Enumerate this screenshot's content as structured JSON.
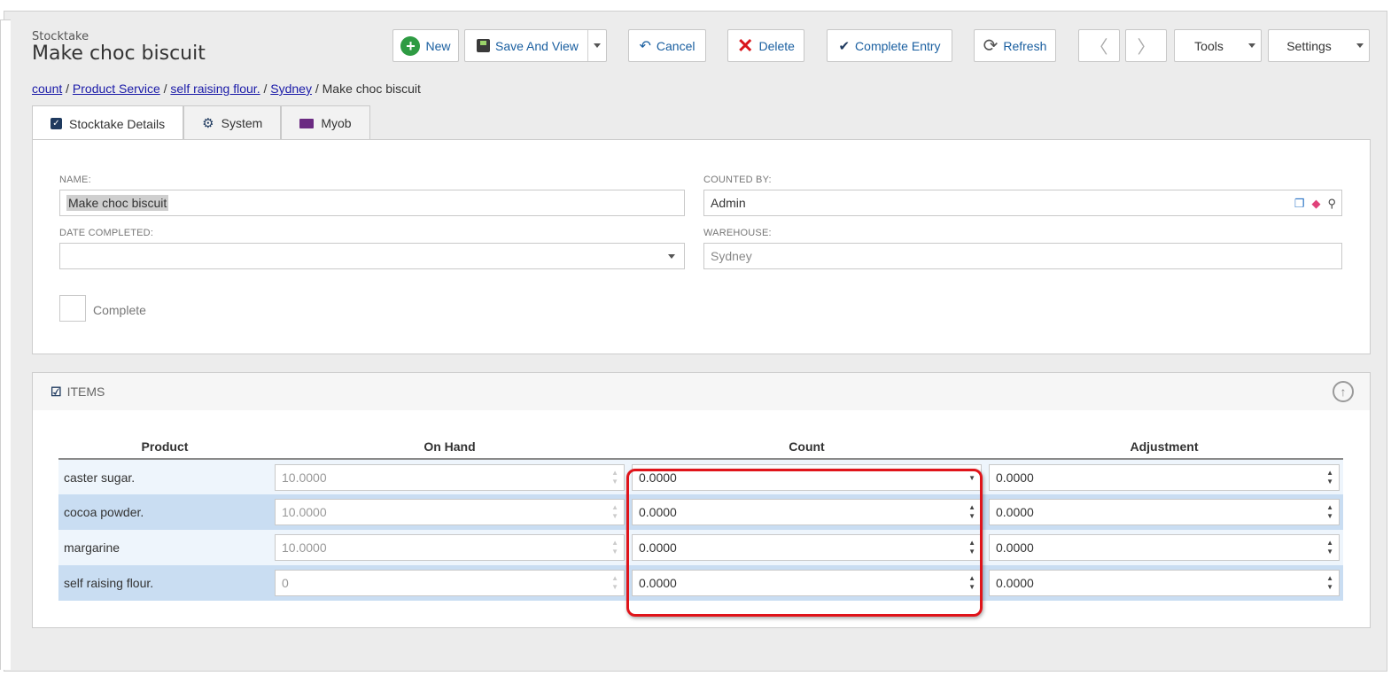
{
  "header": {
    "subtitle": "Stocktake",
    "title": "Make choc biscuit"
  },
  "toolbar": {
    "new_label": "New",
    "save_label": "Save And View",
    "cancel_label": "Cancel",
    "delete_label": "Delete",
    "complete_label": "Complete Entry",
    "refresh_label": "Refresh",
    "prev_label": "〈",
    "next_label": "〉",
    "tools_label": "Tools",
    "settings_label": "Settings"
  },
  "breadcrumb": {
    "items": [
      "count",
      "Product Service",
      "self raising flour.",
      "Sydney"
    ],
    "current": "Make choc biscuit",
    "sep": "/"
  },
  "tabs": [
    {
      "label": "Stocktake Details"
    },
    {
      "label": "System"
    },
    {
      "label": "Myob"
    }
  ],
  "form": {
    "name_label": "NAME:",
    "name_value": "Make choc biscuit",
    "counted_by_label": "COUNTED BY:",
    "counted_by_value": "Admin",
    "date_label": "DATE COMPLETED:",
    "date_value": "",
    "warehouse_label": "WAREHOUSE:",
    "warehouse_value": "Sydney",
    "complete_label": "Complete"
  },
  "items": {
    "title": "ITEMS",
    "columns": [
      "Product",
      "On Hand",
      "Count",
      "Adjustment"
    ],
    "rows": [
      {
        "product": "caster sugar.",
        "on_hand": "10.0000",
        "count": "0.0000",
        "adjustment": "0.0000"
      },
      {
        "product": "cocoa powder.",
        "on_hand": "10.0000",
        "count": "0.0000",
        "adjustment": "0.0000"
      },
      {
        "product": "margarine",
        "on_hand": "10.0000",
        "count": "0.0000",
        "adjustment": "0.0000"
      },
      {
        "product": "self raising flour.",
        "on_hand": "0",
        "count": "0.0000",
        "adjustment": "0.0000"
      }
    ]
  },
  "colors": {
    "link": "#1a1aa8",
    "accent": "#1a5fa0",
    "highlight": "#e0141a",
    "row_alt": "#c9ddf2"
  }
}
